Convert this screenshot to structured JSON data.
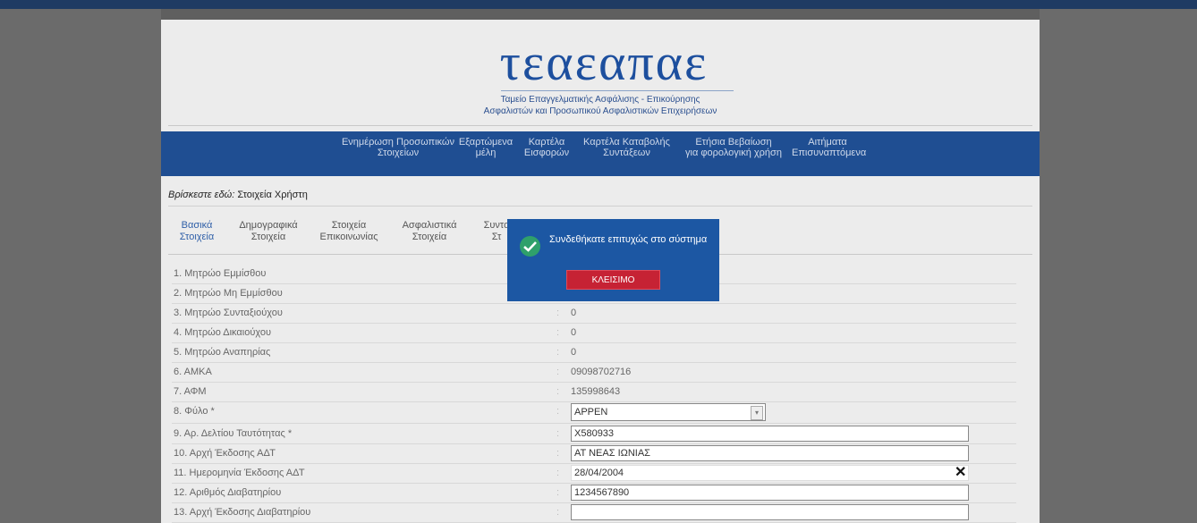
{
  "header": {
    "logo_text": "τεαεαπαε",
    "logo_line1": "Ταμείο Επαγγελματικής Ασφάλισης - Επικούρησης",
    "logo_line2": "Ασφαλιστών και Προσωπικού Ασφαλιστικών Επιχειρήσεων"
  },
  "nav": {
    "items": [
      {
        "l1": "Ενημέρωση Προσωπικών",
        "l2": "Στοιχείων"
      },
      {
        "l1": "Εξαρτώμενα",
        "l2": "μέλη"
      },
      {
        "l1": "Καρτέλα",
        "l2": "Εισφορών"
      },
      {
        "l1": "Καρτέλα Καταβολής",
        "l2": "Συντάξεων"
      },
      {
        "l1": "Ετήσια Βεβαίωση",
        "l2": "για φορολογική χρήση"
      },
      {
        "l1": "Αιτήματα",
        "l2": "Επισυναπτόμενα"
      }
    ]
  },
  "breadcrumb": {
    "prefix": "Βρίσκεστε εδώ:",
    "current": "Στοιχεία Χρήστη"
  },
  "tabs": [
    {
      "l1": "Βασικά",
      "l2": "Στοιχεία"
    },
    {
      "l1": "Δημογραφικά",
      "l2": "Στοιχεία"
    },
    {
      "l1": "Στοιχεία",
      "l2": "Επικοινωνίας"
    },
    {
      "l1": "Ασφαλιστικά",
      "l2": "Στοιχεία"
    },
    {
      "l1": "Συντα",
      "l2": "Στ"
    }
  ],
  "fields": {
    "r1": {
      "label": "1. Μητρώο Εμμίσθου"
    },
    "r2": {
      "label": "2. Μητρώο Μη Εμμίσθου"
    },
    "r3": {
      "label": "3. Μητρώο Συνταξιούχου",
      "value": "0"
    },
    "r4": {
      "label": "4. Μητρώο Δικαιούχου",
      "value": "0"
    },
    "r5": {
      "label": "5. Μητρώο Αναπηρίας",
      "value": "0"
    },
    "r6": {
      "label": "6. ΑΜΚΑ",
      "value": "09098702716"
    },
    "r7": {
      "label": "7. ΑΦΜ",
      "value": "135998643"
    },
    "r8": {
      "label": "8. Φύλο *",
      "value": "ΑΡΡΕΝ"
    },
    "r9": {
      "label": "9. Αρ. Δελτίου Ταυτότητας *",
      "value": "Χ580933"
    },
    "r10": {
      "label": "10. Αρχή Έκδοσης ΑΔΤ",
      "value": "ΑΤ ΝΕΑΣ ΙΩΝΙΑΣ"
    },
    "r11": {
      "label": "11. Ημερομηνία Έκδοσης ΑΔΤ",
      "value": "28/04/2004"
    },
    "r12": {
      "label": "12. Αριθμός Διαβατηρίου",
      "value": "1234567890"
    },
    "r13": {
      "label": "13. Αρχή Έκδοσης Διαβατηρίου",
      "value": ""
    },
    "sep": ":"
  },
  "dialog": {
    "message": "Συνδεθήκατε επιτυχώς στο σύστημα",
    "button": "ΚΛΕΙΣΙΜΟ"
  }
}
